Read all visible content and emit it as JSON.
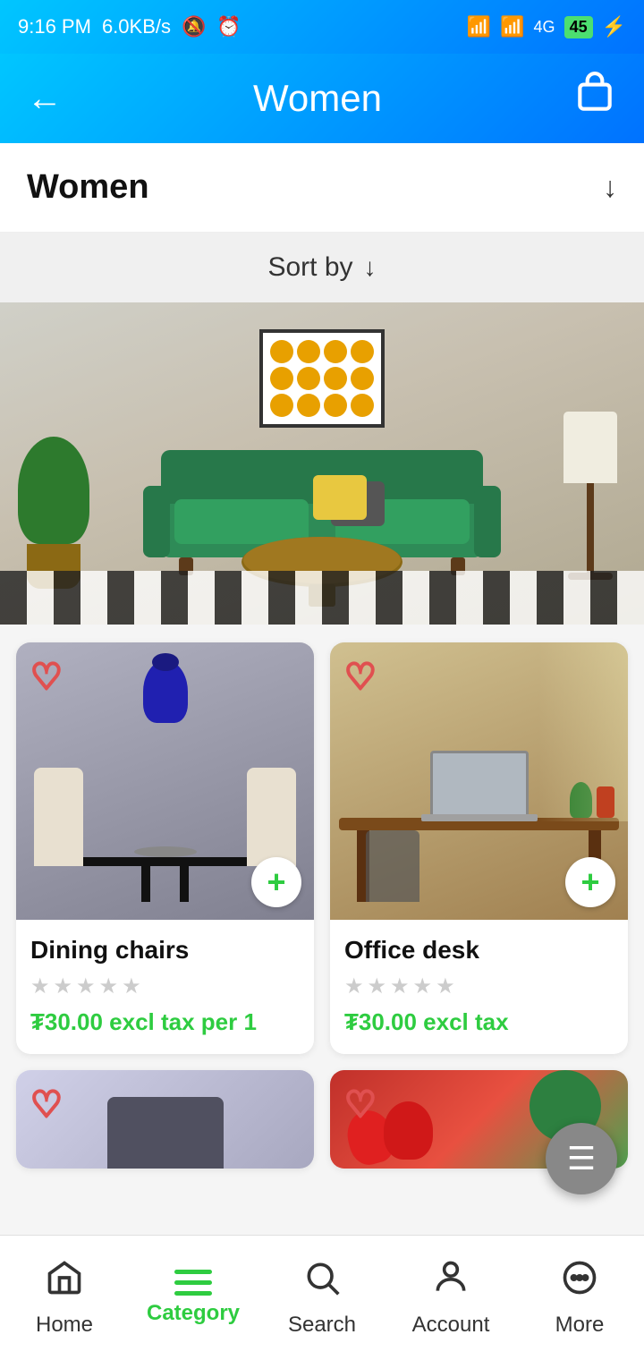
{
  "statusBar": {
    "time": "9:16 PM",
    "speed": "6.0KB/s",
    "battery": "45"
  },
  "header": {
    "backLabel": "←",
    "title": "Women",
    "cartIcon": "cart-icon"
  },
  "sectionTitle": {
    "label": "Women",
    "arrowIcon": "chevron-down-icon"
  },
  "sortBar": {
    "label": "Sort by",
    "arrowIcon": "sort-arrow-icon"
  },
  "products": [
    {
      "id": "dining-chairs",
      "name": "Dining chairs",
      "stars": [
        0,
        0,
        0,
        0,
        0
      ],
      "price": "₮30.00 excl tax per 1",
      "heartFilled": false
    },
    {
      "id": "office-desk",
      "name": "Office desk",
      "stars": [
        0,
        0,
        0,
        0,
        0
      ],
      "price": "₮30.00 excl tax",
      "heartFilled": false
    }
  ],
  "addButtonLabel": "+",
  "floatingFilterIcon": "filter-icon",
  "bottomNav": {
    "items": [
      {
        "id": "home",
        "label": "Home",
        "icon": "home-icon",
        "active": false
      },
      {
        "id": "category",
        "label": "Category",
        "icon": "category-icon",
        "active": true
      },
      {
        "id": "search",
        "label": "Search",
        "icon": "search-icon",
        "active": false
      },
      {
        "id": "account",
        "label": "Account",
        "icon": "account-icon",
        "active": false
      },
      {
        "id": "more",
        "label": "More",
        "icon": "more-icon",
        "active": false
      }
    ]
  }
}
